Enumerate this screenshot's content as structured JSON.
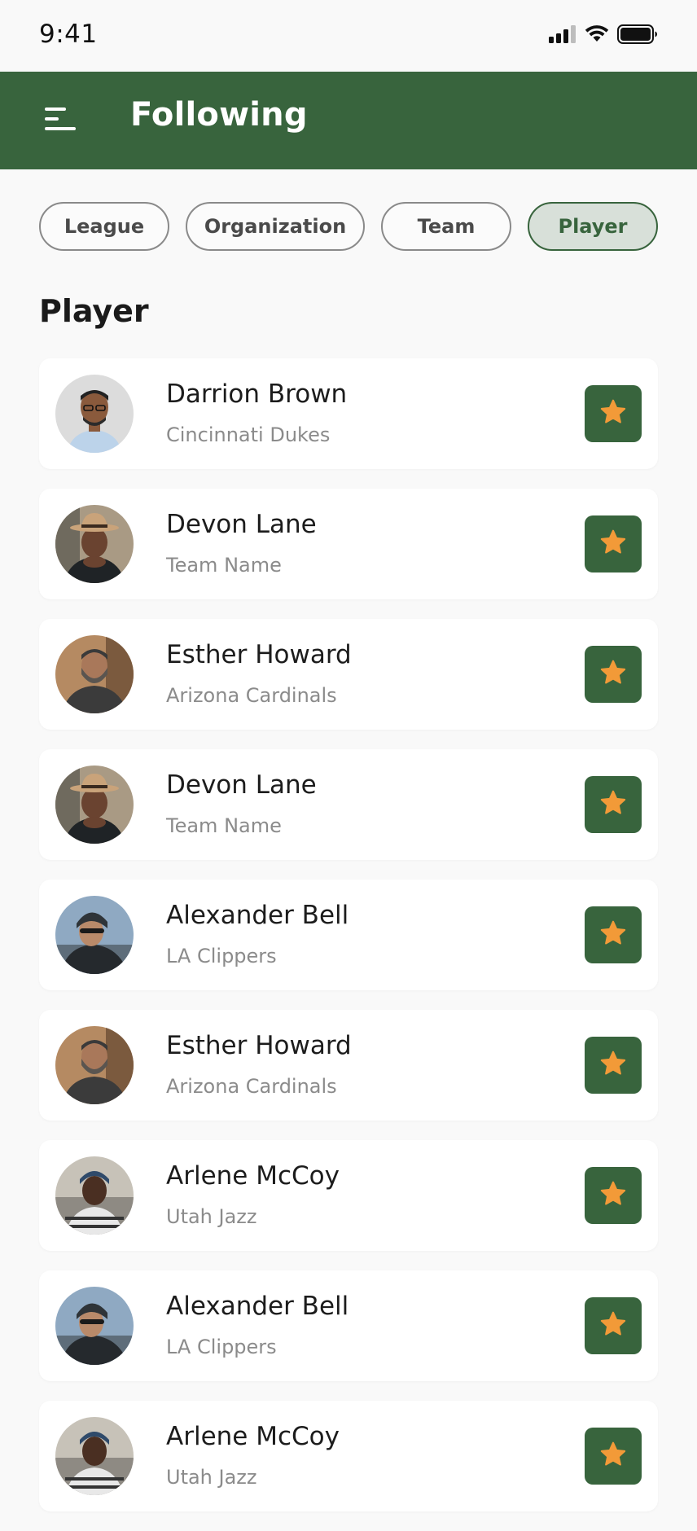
{
  "status_bar": {
    "time": "9:41",
    "icons": [
      "cellular-signal-icon",
      "wifi-icon",
      "battery-icon"
    ]
  },
  "header": {
    "title": "Following",
    "menu_icon": "menu-icon",
    "background_color": "#38643d"
  },
  "filters": {
    "items": [
      {
        "label": "League",
        "active": false
      },
      {
        "label": "Organization",
        "active": false
      },
      {
        "label": "Team",
        "active": false
      },
      {
        "label": "Player",
        "active": true
      }
    ]
  },
  "section": {
    "title": "Player"
  },
  "players": [
    {
      "name": "Darrion Brown",
      "team": "Cincinnati Dukes",
      "favorite": true
    },
    {
      "name": "Devon Lane",
      "team": "Team Name",
      "favorite": true
    },
    {
      "name": "Esther Howard",
      "team": "Arizona Cardinals",
      "favorite": true
    },
    {
      "name": "Devon Lane",
      "team": "Team Name",
      "favorite": true
    },
    {
      "name": "Alexander Bell",
      "team": "LA Clippers",
      "favorite": true
    },
    {
      "name": "Esther Howard",
      "team": "Arizona Cardinals",
      "favorite": true
    },
    {
      "name": "Arlene McCoy",
      "team": "Utah Jazz",
      "favorite": true
    },
    {
      "name": "Alexander Bell",
      "team": "LA Clippers",
      "favorite": true
    },
    {
      "name": "Arlene McCoy",
      "team": "Utah Jazz",
      "favorite": true
    }
  ],
  "colors": {
    "accent": "#38643d",
    "star": "#f29a38",
    "chip_active_bg": "#d8e0d9"
  }
}
